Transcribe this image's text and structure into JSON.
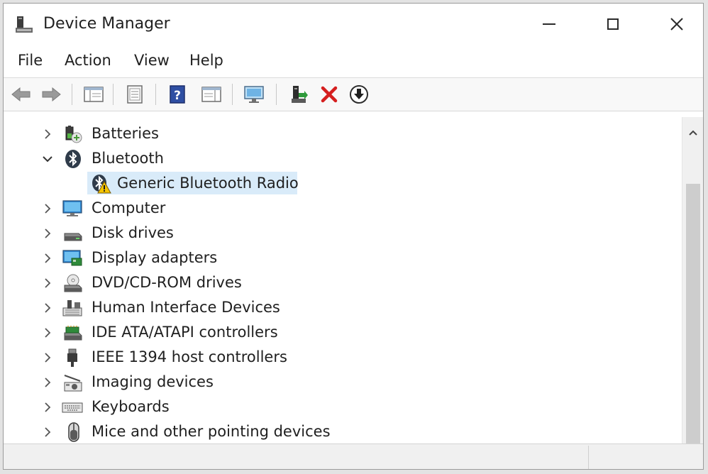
{
  "window": {
    "title": "Device Manager"
  },
  "menu": [
    "File",
    "Action",
    "View",
    "Help"
  ],
  "toolbar": {
    "buttons": [
      "back-arrow-icon",
      "forward-arrow-icon",
      "console-tree-icon",
      "properties-icon",
      "help-icon",
      "action-pane-icon",
      "monitor-scan-icon",
      "update-driver-icon",
      "uninstall-x-icon",
      "disable-down-arrow-icon"
    ]
  },
  "tree": {
    "items": [
      {
        "label": "Batteries",
        "expanded": false,
        "icon": "battery-icon"
      },
      {
        "label": "Bluetooth",
        "expanded": true,
        "icon": "bluetooth-icon"
      },
      {
        "label": "Generic Bluetooth Radio",
        "child": true,
        "selected": true,
        "icon": "bluetooth-warning-icon"
      },
      {
        "label": "Computer",
        "expanded": false,
        "icon": "computer-icon"
      },
      {
        "label": "Disk drives",
        "expanded": false,
        "icon": "disk-drive-icon"
      },
      {
        "label": "Display adapters",
        "expanded": false,
        "icon": "display-adapter-icon"
      },
      {
        "label": "DVD/CD-ROM drives",
        "expanded": false,
        "icon": "dvd-drive-icon"
      },
      {
        "label": "Human Interface Devices",
        "expanded": false,
        "icon": "hid-icon"
      },
      {
        "label": "IDE ATA/ATAPI controllers",
        "expanded": false,
        "icon": "ide-controller-icon"
      },
      {
        "label": "IEEE 1394 host controllers",
        "expanded": false,
        "icon": "ieee1394-icon"
      },
      {
        "label": "Imaging devices",
        "expanded": false,
        "icon": "camera-icon"
      },
      {
        "label": "Keyboards",
        "expanded": false,
        "icon": "keyboard-icon"
      },
      {
        "label": "Mice and other pointing devices",
        "expanded": false,
        "icon": "mouse-icon"
      }
    ]
  },
  "colors": {
    "selection": "#d9ebf9",
    "toolbar_bg": "#f8f8f8",
    "scroll_thumb": "#cdcdcd",
    "warning": "#f5c400"
  }
}
